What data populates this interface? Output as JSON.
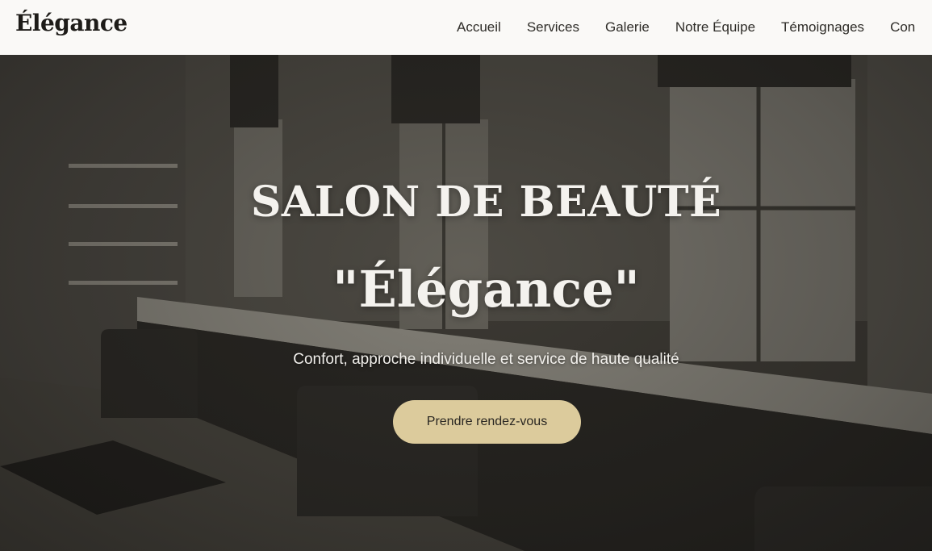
{
  "header": {
    "logo": "Élégance",
    "nav": [
      "Accueil",
      "Services",
      "Galerie",
      "Notre Équipe",
      "Témoignages",
      "Con"
    ]
  },
  "hero": {
    "title_line1": "SALON DE BEAUTÉ",
    "title_line2": "\"Élégance\"",
    "subtitle": "Confort, approche individuelle et service de haute qualité",
    "cta": "Prendre rendez-vous"
  },
  "colors": {
    "header_bg": "#faf9f7",
    "cta_bg": "#dccb9c",
    "hero_text": "#f4f2ee"
  }
}
